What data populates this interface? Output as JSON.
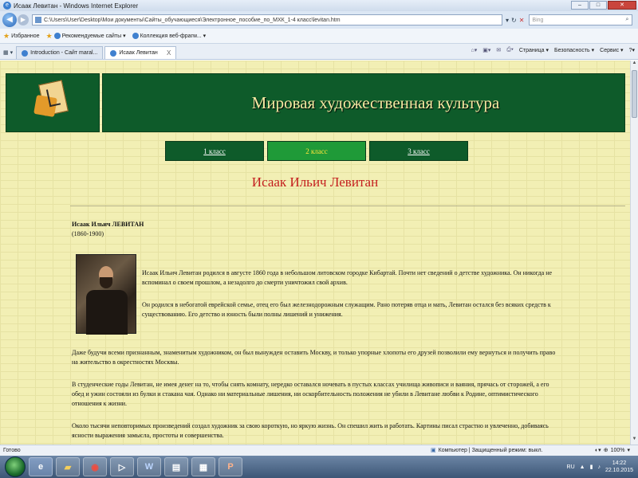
{
  "window": {
    "title": "Исаак Левитан - Windows Internet Explorer",
    "controls": [
      "–",
      "□",
      "✕"
    ]
  },
  "address": {
    "url": "C:\\Users\\User\\Desktop\\Мои документы\\Сайты_обучающиеся\\Электронное_пособие_по_МХК_1-4 класс\\levitan.htm",
    "search_placeholder": "Bing"
  },
  "favorites": {
    "items": [
      "Избранное",
      "Рекомендуемые сайты ▾",
      "Коллекция веб-фрагм... ▾"
    ]
  },
  "tabs": {
    "items": [
      "Introduction - Сайт maral...",
      "Исаак Левитан"
    ],
    "close_glyph": "X"
  },
  "commands": [
    "Страница ▾",
    "Безопасность ▾",
    "Сервис ▾",
    "?▾"
  ],
  "page": {
    "site_title": "Мировая художественная культура",
    "nav": [
      "1 класс",
      "2 класс",
      "3 класс"
    ],
    "heading": "Исаак Ильич Левитан",
    "name_line": "Исаак Ильич ЛЕВИТАН",
    "years": "(1860-1900)",
    "paragraphs": [
      "Исаак Ильич Левитан родился в августе 1860 года в небольшом литовском городке Кибартай. Почти нет сведений о детстве художника. Он никогда не вспоминал о своем прошлом, а незадолго до смерти уничтожил свой архив.",
      "Он родился в небогатой еврейской семье, отец его был железнодорожным служащим. Рано потеряв отца и мать, Левитан остался без всяких средств к существованию. Его детство и юность были полны лишений и унижения.",
      "Даже будучи всеми признанным, знаменитым художником, он был вынужден оставить Москву, и только упорные хлопоты его друзей позволили ему вернуться и получить право на жительство в окрестностях Москвы.",
      "В студенческие годы Левитан, не имея денег на то, чтобы снять комнату, нередко оставался ночевать в пустых классах училища живописи и ваяния, прячась от сторожей, а его обед и ужин состояли из булки и стакана чая. Однако ни материальные лишения, ни оскорбительность положения не убили в Левитане любви к Родине, оптимистического отношения к жизни.",
      "Около тысячи неповторимых произведений создал художник за свою короткую, но яркую жизнь. Он спешил жить и работать. Картины писал страстно и увлеченно, добиваясь ясности выражения замысла, простоты и совершенства."
    ]
  },
  "status": {
    "left": "Готово",
    "zone": "Компьютер | Защищенный режим: выкл.",
    "zoom": "100%"
  },
  "taskbar": {
    "lang": "RU",
    "time": "14:22",
    "date": "22.10.2015"
  }
}
